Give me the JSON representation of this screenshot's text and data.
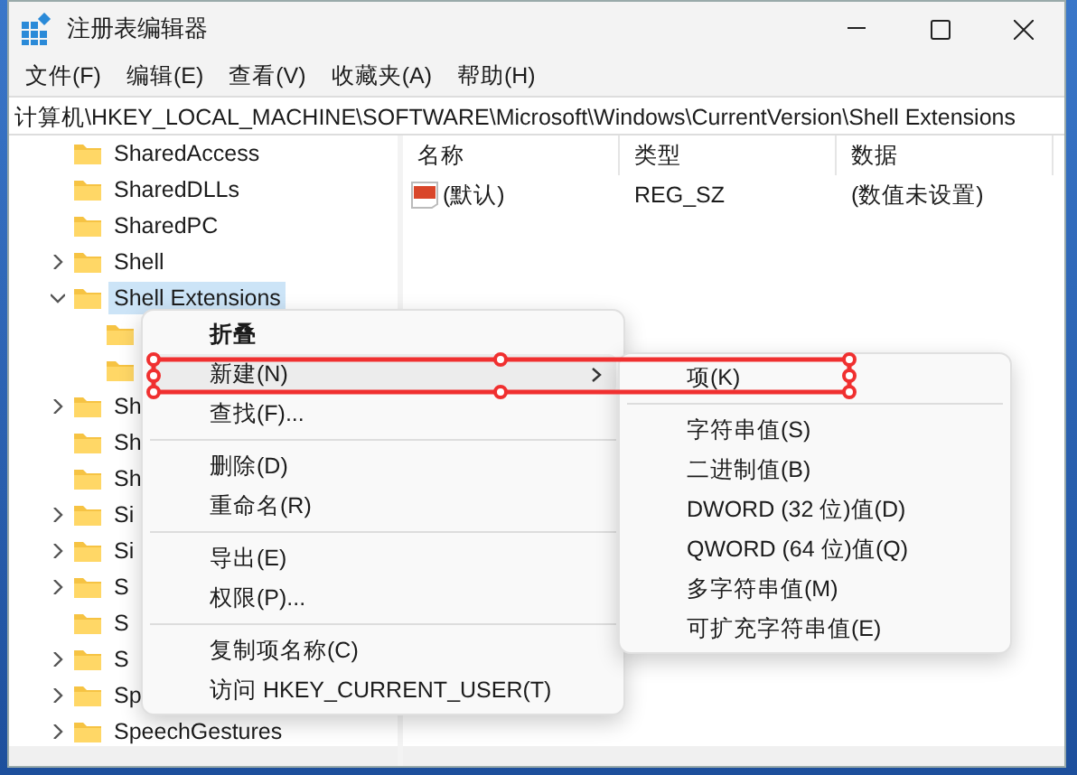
{
  "window": {
    "title": "注册表编辑器"
  },
  "menu_bar": [
    "文件(F)",
    "编辑(E)",
    "查看(V)",
    "收藏夹(A)",
    "帮助(H)"
  ],
  "address": "计算机\\HKEY_LOCAL_MACHINE\\SOFTWARE\\Microsoft\\Windows\\CurrentVersion\\Shell Extensions",
  "tree": [
    {
      "label": "SharedAccess",
      "selected": false
    },
    {
      "label": "SharedDLLs",
      "selected": false
    },
    {
      "label": "SharedPC",
      "selected": false
    },
    {
      "label": "Shell",
      "expanded": false,
      "selected": false
    },
    {
      "label": "Shell Extensions",
      "expanded": true,
      "selected": true,
      "children": [
        {
          "kind": "folder"
        },
        {
          "kind": "folder"
        }
      ]
    },
    {
      "label": "Sh",
      "expanded": false,
      "selected": false
    },
    {
      "label": "Sh",
      "selected": false
    },
    {
      "label": "Sh",
      "selected": false
    },
    {
      "label": "Si",
      "expanded": false,
      "selected": false
    },
    {
      "label": "Si",
      "expanded": false,
      "selected": false
    },
    {
      "label": "S",
      "expanded": false,
      "selected": false
    },
    {
      "label": "S",
      "selected": false
    },
    {
      "label": "S",
      "expanded": false,
      "selected": false
    },
    {
      "label": "Sp",
      "expanded": false,
      "selected": false
    },
    {
      "label": "SpeechGestures",
      "expanded": false,
      "selected": false
    }
  ],
  "values_table": {
    "columns": [
      "名称",
      "类型",
      "数据"
    ],
    "rows": [
      {
        "name": "(默认)",
        "type": "REG_SZ",
        "data": "(数值未设置)"
      }
    ]
  },
  "context_menu": [
    {
      "kind": "item",
      "label": "折叠",
      "default": true,
      "submenu": false,
      "selected": false
    },
    {
      "kind": "item",
      "label": "新建(N)",
      "default": false,
      "submenu": true,
      "selected": true
    },
    {
      "kind": "item",
      "label": "查找(F)...",
      "default": false,
      "submenu": false,
      "selected": false
    },
    {
      "kind": "separator"
    },
    {
      "kind": "item",
      "label": "删除(D)",
      "default": false,
      "submenu": false,
      "selected": false
    },
    {
      "kind": "item",
      "label": "重命名(R)",
      "default": false,
      "submenu": false,
      "selected": false
    },
    {
      "kind": "separator"
    },
    {
      "kind": "item",
      "label": "导出(E)",
      "default": false,
      "submenu": false,
      "selected": false
    },
    {
      "kind": "item",
      "label": "权限(P)...",
      "default": false,
      "submenu": false,
      "selected": false
    },
    {
      "kind": "separator"
    },
    {
      "kind": "item",
      "label": "复制项名称(C)",
      "default": false,
      "submenu": false,
      "selected": false
    },
    {
      "kind": "item",
      "label": "访问 HKEY_CURRENT_USER(T)",
      "default": false,
      "submenu": false,
      "selected": false
    }
  ],
  "submenu": [
    {
      "kind": "item",
      "label": "项(K)",
      "selected": false
    },
    {
      "kind": "separator"
    },
    {
      "kind": "item",
      "label": "字符串值(S)",
      "selected": false
    },
    {
      "kind": "item",
      "label": "二进制值(B)",
      "selected": false
    },
    {
      "kind": "item",
      "label": "DWORD (32 位)值(D)",
      "selected": false
    },
    {
      "kind": "item",
      "label": "QWORD (64 位)值(Q)",
      "selected": false
    },
    {
      "kind": "item",
      "label": "多字符串值(M)",
      "selected": false
    },
    {
      "kind": "item",
      "label": "可扩充字符串值(E)",
      "selected": false
    }
  ]
}
